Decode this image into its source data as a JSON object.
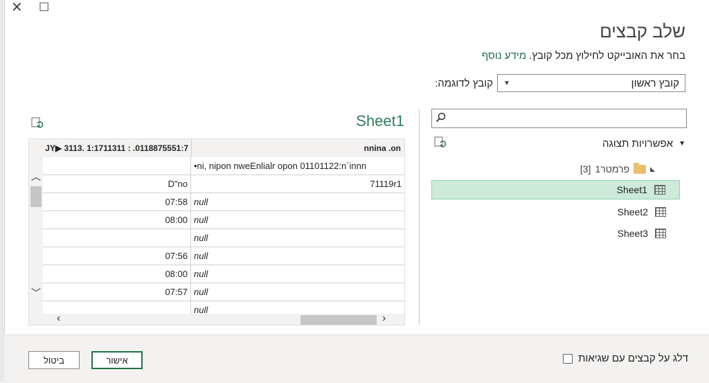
{
  "window": {
    "close_glyph": "✕",
    "maximize_glyph": "☐"
  },
  "dialog": {
    "title": "שלב קבצים",
    "subtitle_text": "בחר את האובייקט לחילוץ מכל קובץ.",
    "more_info_link": "מידע נוסף",
    "sample_file_label": "קובץ לדוגמה:",
    "sample_file_value": "קובץ ראשון"
  },
  "navigator": {
    "search_placeholder": "",
    "display_options_label": "אפשרויות תצוגה",
    "folder": {
      "name": "פרמטר1",
      "count": "[3]"
    },
    "items": [
      {
        "label": "Sheet1",
        "selected": true
      },
      {
        "label": "Sheet2",
        "selected": false
      },
      {
        "label": "Sheet3",
        "selected": false
      }
    ]
  },
  "preview": {
    "title": "Sheet1",
    "columns": [
      "nnina .on",
      "JY▶ 3113. 1:1711311 : .0118875551:7"
    ],
    "rows": [
      [
        "•ni, nipon nweEnlialr opon 01101122:n`innn",
        ""
      ],
      [
        "71119r1",
        "D\"no"
      ],
      [
        "null",
        "07:58"
      ],
      [
        "null",
        "08:00"
      ],
      [
        "null",
        ""
      ],
      [
        "null",
        "07:56"
      ],
      [
        "null",
        "08:00"
      ],
      [
        "null",
        "07:57"
      ],
      [
        "null",
        ""
      ]
    ]
  },
  "footer": {
    "skip_errors_label": "דלג על קבצים עם שגיאות",
    "ok_label": "אישור",
    "cancel_label": "ביטול"
  },
  "icons": {
    "search": "search-icon",
    "refresh": "refresh-icon",
    "folder": "folder-icon",
    "sheet": "table-icon"
  },
  "colors": {
    "accent": "#217346",
    "selection": "#cdeadb",
    "title_green": "#2e7d5b"
  }
}
